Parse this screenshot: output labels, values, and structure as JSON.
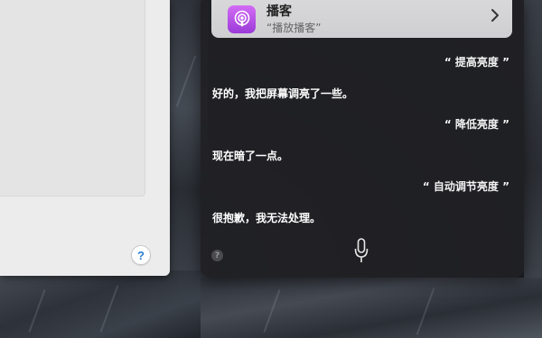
{
  "siri": {
    "card": {
      "title": "播客",
      "subtitle": "“播放播客”",
      "icon": "podcasts-icon",
      "icon_color": "#b04ee6"
    },
    "conversation": [
      {
        "role": "user",
        "text": "“ 提高亮度 ”"
      },
      {
        "role": "siri",
        "text": "好的，我把屏幕调亮了一些。"
      },
      {
        "role": "user",
        "text": "“ 降低亮度 ”"
      },
      {
        "role": "siri",
        "text": "现在暗了一点。"
      },
      {
        "role": "user",
        "text": "“ 自动调节亮度 ”"
      },
      {
        "role": "siri",
        "text": "很抱歉，我无法处理。"
      }
    ],
    "help_symbol": "?",
    "mic_icon": "microphone-icon"
  },
  "left_window": {
    "help_symbol": "?",
    "help_color": "#2b7cd3"
  }
}
